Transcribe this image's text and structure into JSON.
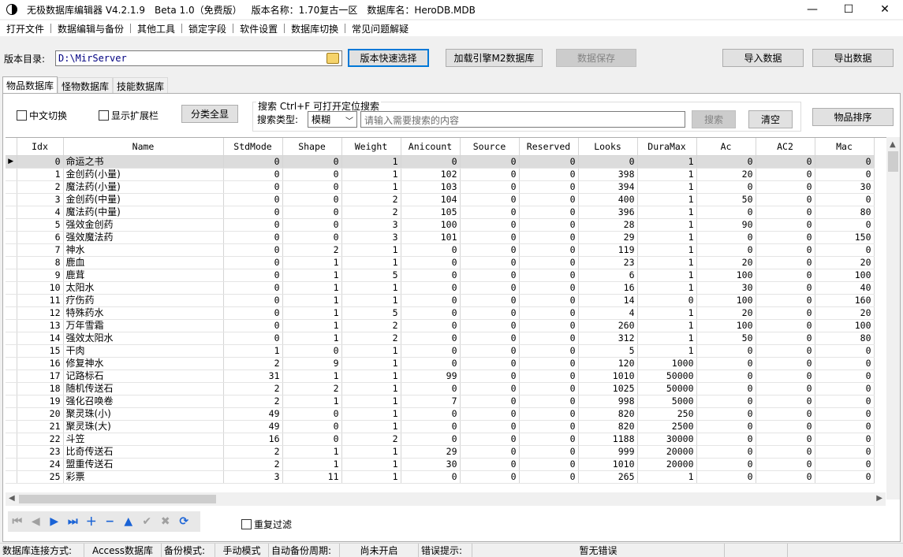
{
  "window": {
    "title_segments": [
      "无极数据库编辑器 V4.2.1.9",
      "Beta 1.0（免费版）",
      "版本名称：1.70复古一区",
      "数据库名：HeroDB.MDB"
    ],
    "minimize": "—",
    "maximize": "☐",
    "close": "✕"
  },
  "menu": [
    "打开文件",
    "数据编辑与备份",
    "其他工具",
    "锁定字段",
    "软件设置",
    "数据库切换",
    "常见问题解疑"
  ],
  "dirbar": {
    "label": "版本目录:",
    "path": "D:\\MirServer",
    "quick_select": "版本快速选择",
    "load_engine": "加载引擎M2数据库",
    "save_data": "数据保存",
    "import": "导入数据",
    "export": "导出数据"
  },
  "tabs": [
    "物品数据库",
    "怪物数据库",
    "技能数据库"
  ],
  "toolbar": {
    "chinese_toggle": "中文切换",
    "show_ext": "显示扩展栏",
    "show_all": "分类全显",
    "search_caption": "搜索  Ctrl+F 可打开定位搜索",
    "search_type_label": "搜索类型:",
    "search_type_value": "模糊",
    "search_placeholder": "请输入需要搜索的内容",
    "search_button": "搜索",
    "clear_button": "清空",
    "sort_button": "物品排序"
  },
  "grid": {
    "columns": [
      "Idx",
      "Name",
      "StdMode",
      "Shape",
      "Weight",
      "Anicount",
      "Source",
      "Reserved",
      "Looks",
      "DuraMax",
      "Ac",
      "AC2",
      "Mac"
    ],
    "rows": [
      [
        0,
        "命运之书",
        0,
        0,
        1,
        0,
        0,
        0,
        0,
        1,
        0,
        0,
        0
      ],
      [
        1,
        "金创药(小量)",
        0,
        0,
        1,
        102,
        0,
        0,
        398,
        1,
        20,
        0,
        0
      ],
      [
        2,
        "魔法药(小量)",
        0,
        0,
        1,
        103,
        0,
        0,
        394,
        1,
        0,
        0,
        30
      ],
      [
        3,
        "金创药(中量)",
        0,
        0,
        2,
        104,
        0,
        0,
        400,
        1,
        50,
        0,
        0
      ],
      [
        4,
        "魔法药(中量)",
        0,
        0,
        2,
        105,
        0,
        0,
        396,
        1,
        0,
        0,
        80
      ],
      [
        5,
        "强效金创药",
        0,
        0,
        3,
        100,
        0,
        0,
        28,
        1,
        90,
        0,
        0
      ],
      [
        6,
        "强效魔法药",
        0,
        0,
        3,
        101,
        0,
        0,
        29,
        1,
        0,
        0,
        150
      ],
      [
        7,
        "神水",
        0,
        2,
        1,
        0,
        0,
        0,
        119,
        1,
        0,
        0,
        0
      ],
      [
        8,
        "鹿血",
        0,
        1,
        1,
        0,
        0,
        0,
        23,
        1,
        20,
        0,
        20
      ],
      [
        9,
        "鹿茸",
        0,
        1,
        5,
        0,
        0,
        0,
        6,
        1,
        100,
        0,
        100
      ],
      [
        10,
        "太阳水",
        0,
        1,
        1,
        0,
        0,
        0,
        16,
        1,
        30,
        0,
        40
      ],
      [
        11,
        "疗伤药",
        0,
        1,
        1,
        0,
        0,
        0,
        14,
        0,
        100,
        0,
        160
      ],
      [
        12,
        "特殊药水",
        0,
        1,
        5,
        0,
        0,
        0,
        4,
        1,
        20,
        0,
        20
      ],
      [
        13,
        "万年雪霜",
        0,
        1,
        2,
        0,
        0,
        0,
        260,
        1,
        100,
        0,
        100
      ],
      [
        14,
        "强效太阳水",
        0,
        1,
        2,
        0,
        0,
        0,
        312,
        1,
        50,
        0,
        80
      ],
      [
        15,
        "干肉",
        1,
        0,
        1,
        0,
        0,
        0,
        5,
        1,
        0,
        0,
        0
      ],
      [
        16,
        "修复神水",
        2,
        9,
        1,
        0,
        0,
        0,
        120,
        1000,
        0,
        0,
        0
      ],
      [
        17,
        "记路标石",
        31,
        1,
        1,
        99,
        0,
        0,
        1010,
        50000,
        0,
        0,
        0
      ],
      [
        18,
        "随机传送石",
        2,
        2,
        1,
        0,
        0,
        0,
        1025,
        50000,
        0,
        0,
        0
      ],
      [
        19,
        "强化召唤卷",
        2,
        1,
        1,
        7,
        0,
        0,
        998,
        5000,
        0,
        0,
        0
      ],
      [
        20,
        "聚灵珠(小)",
        49,
        0,
        1,
        0,
        0,
        0,
        820,
        250,
        0,
        0,
        0
      ],
      [
        21,
        "聚灵珠(大)",
        49,
        0,
        1,
        0,
        0,
        0,
        820,
        2500,
        0,
        0,
        0
      ],
      [
        22,
        "斗笠",
        16,
        0,
        2,
        0,
        0,
        0,
        1188,
        30000,
        0,
        0,
        0
      ],
      [
        23,
        "比奇传送石",
        2,
        1,
        1,
        29,
        0,
        0,
        999,
        20000,
        0,
        0,
        0
      ],
      [
        24,
        "盟重传送石",
        2,
        1,
        1,
        30,
        0,
        0,
        1010,
        20000,
        0,
        0,
        0
      ],
      [
        25,
        "彩票",
        3,
        11,
        1,
        0,
        0,
        0,
        265,
        1,
        0,
        0,
        0
      ]
    ]
  },
  "bottom": {
    "repeat_filter": "重复过滤"
  },
  "status": {
    "conn_label": "数据库连接方式:",
    "conn_value": "Access数据库",
    "backup_label": "备份模式:",
    "backup_value": "手动模式",
    "auto_label": "自动备份周期:",
    "auto_value": "尚未开启",
    "err_label": "错误提示:",
    "err_value": "暂无错误"
  }
}
